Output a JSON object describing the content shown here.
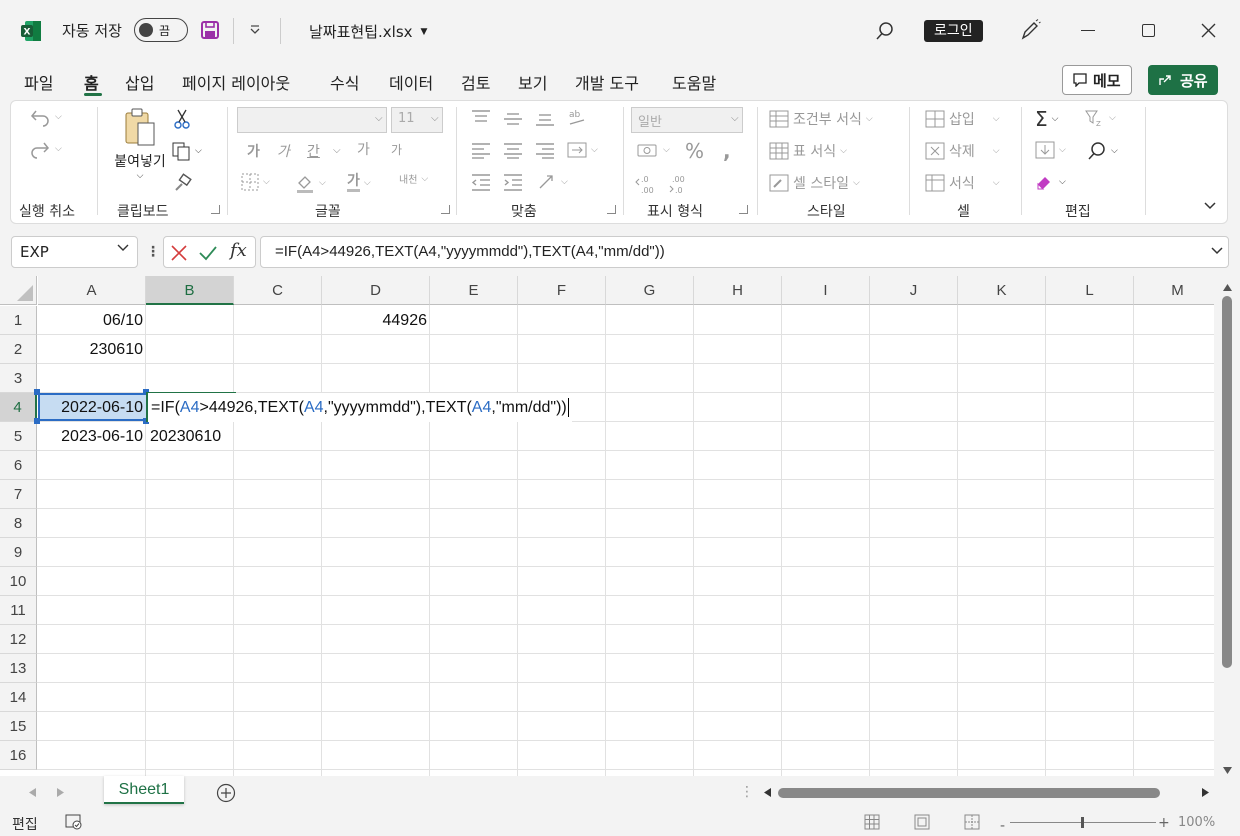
{
  "titlebar": {
    "autosave_label": "자동 저장",
    "toggle_state": "끔",
    "filename": "날짜표현팁.xlsx",
    "login": "로그인"
  },
  "menu": {
    "items": [
      "파일",
      "홈",
      "삽입",
      "페이지 레이아웃",
      "수식",
      "데이터",
      "검토",
      "보기",
      "개발 도구",
      "도움말"
    ],
    "active": "홈",
    "memo": "메모",
    "share": "공유"
  },
  "ribbon": {
    "groups": {
      "undo": "실행 취소",
      "clipboard": "클립보드",
      "font": "글꼴",
      "alignment": "맞춤",
      "number": "표시 형식",
      "styles": "스타일",
      "cells": "셀",
      "editing": "편집"
    },
    "paste": "붙여넣기",
    "font_size": "11",
    "number_format": "일반",
    "styles_items": [
      "조건부 서식",
      "표 서식",
      "셀 스타일"
    ],
    "cells_items": [
      "삽입",
      "삭제",
      "서식"
    ],
    "font_buttons": [
      "가",
      "가",
      "간",
      "가",
      "가"
    ],
    "wrap_label": "내천"
  },
  "formula_bar": {
    "name_box": "EXP",
    "formula": "=IF(A4>44926,TEXT(A4,\"yyyymmdd\"),TEXT(A4,\"mm/dd\"))"
  },
  "grid": {
    "columns": [
      "A",
      "B",
      "C",
      "D",
      "E",
      "F",
      "G",
      "H",
      "I",
      "J",
      "K",
      "L",
      "M"
    ],
    "rows": [
      "1",
      "2",
      "3",
      "4",
      "5",
      "6",
      "7",
      "8",
      "9",
      "10",
      "11",
      "12",
      "13",
      "14",
      "15",
      "16"
    ],
    "selected_column": "B",
    "selected_row": "4",
    "cells": {
      "A1": "06/10",
      "D1": "44926",
      "A2": "230610",
      "A4": "2022-06-10",
      "A5": "2023-06-10",
      "B5": "20230610"
    },
    "edit_parts": [
      "=IF(",
      "A4",
      ">44926,TEXT(",
      "A4",
      ",\"yyyymmdd\"),TEXT(",
      "A4",
      ",\"mm/dd\"))"
    ]
  },
  "tabs": {
    "sheets": [
      "Sheet1"
    ]
  },
  "status": {
    "mode": "편집",
    "zoom": "100%"
  },
  "colors": {
    "accent": "#217346",
    "reference": "#2b6cc4",
    "selection_fill": "#c6dcf2"
  }
}
